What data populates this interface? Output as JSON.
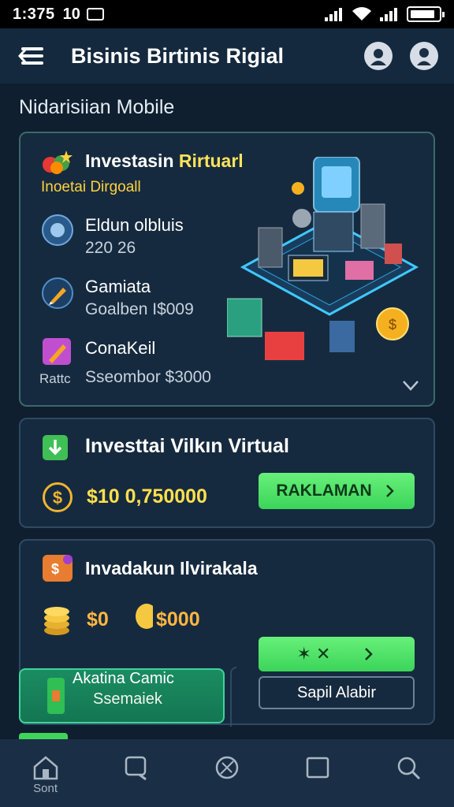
{
  "status_bar": {
    "time": "1:375",
    "indicator": "10",
    "icons": [
      "screenshot-icon",
      "signal-icon",
      "wifi-icon",
      "signal-icon",
      "battery-icon"
    ]
  },
  "header": {
    "title": "Bisinis Birtinis Rigial",
    "icons": [
      "menu-icon",
      "account-icon",
      "user-icon"
    ]
  },
  "page": {
    "subtitle": "Nidarisiian Mobile"
  },
  "card1": {
    "title_prefix": "Investasin ",
    "title_accent": "Rirtuarl",
    "tag": "Inoetai Dirgoall",
    "rows": [
      {
        "label": "Eldun olbluis",
        "value": "220 26",
        "icon": "globe-icon"
      },
      {
        "label": "Gamiata",
        "value": "Goalben I$009",
        "icon": "pen-icon"
      },
      {
        "label": "ConaKeil",
        "value": "Sseombor $3000",
        "small": "Rattc",
        "icon": "tag-icon"
      }
    ]
  },
  "card2": {
    "title": "Investtai Vilkın Virtual",
    "amount": "$10 0,750000",
    "button": "RAKLAMAN"
  },
  "card3": {
    "title": "Invadakun Ilvirakala",
    "value1": "$0",
    "value2": "$000",
    "green_button": "✶ ✕",
    "outline_button": "Sapil Alabir"
  },
  "promo": {
    "title": "Akatina Camic",
    "subtitle": "Ssemaiek"
  },
  "bottom_nav": {
    "items": [
      {
        "label": "Sont",
        "icon": "home-icon"
      },
      {
        "label": "",
        "icon": "chat-icon"
      },
      {
        "label": "",
        "icon": "compass-icon"
      },
      {
        "label": "",
        "icon": "square-icon"
      },
      {
        "label": "",
        "icon": "search-icon"
      }
    ]
  },
  "colors": {
    "background": "#0f1f30",
    "card": "#162a3f",
    "accent_green": "#3fd45a",
    "accent_yellow": "#ffe04c"
  }
}
